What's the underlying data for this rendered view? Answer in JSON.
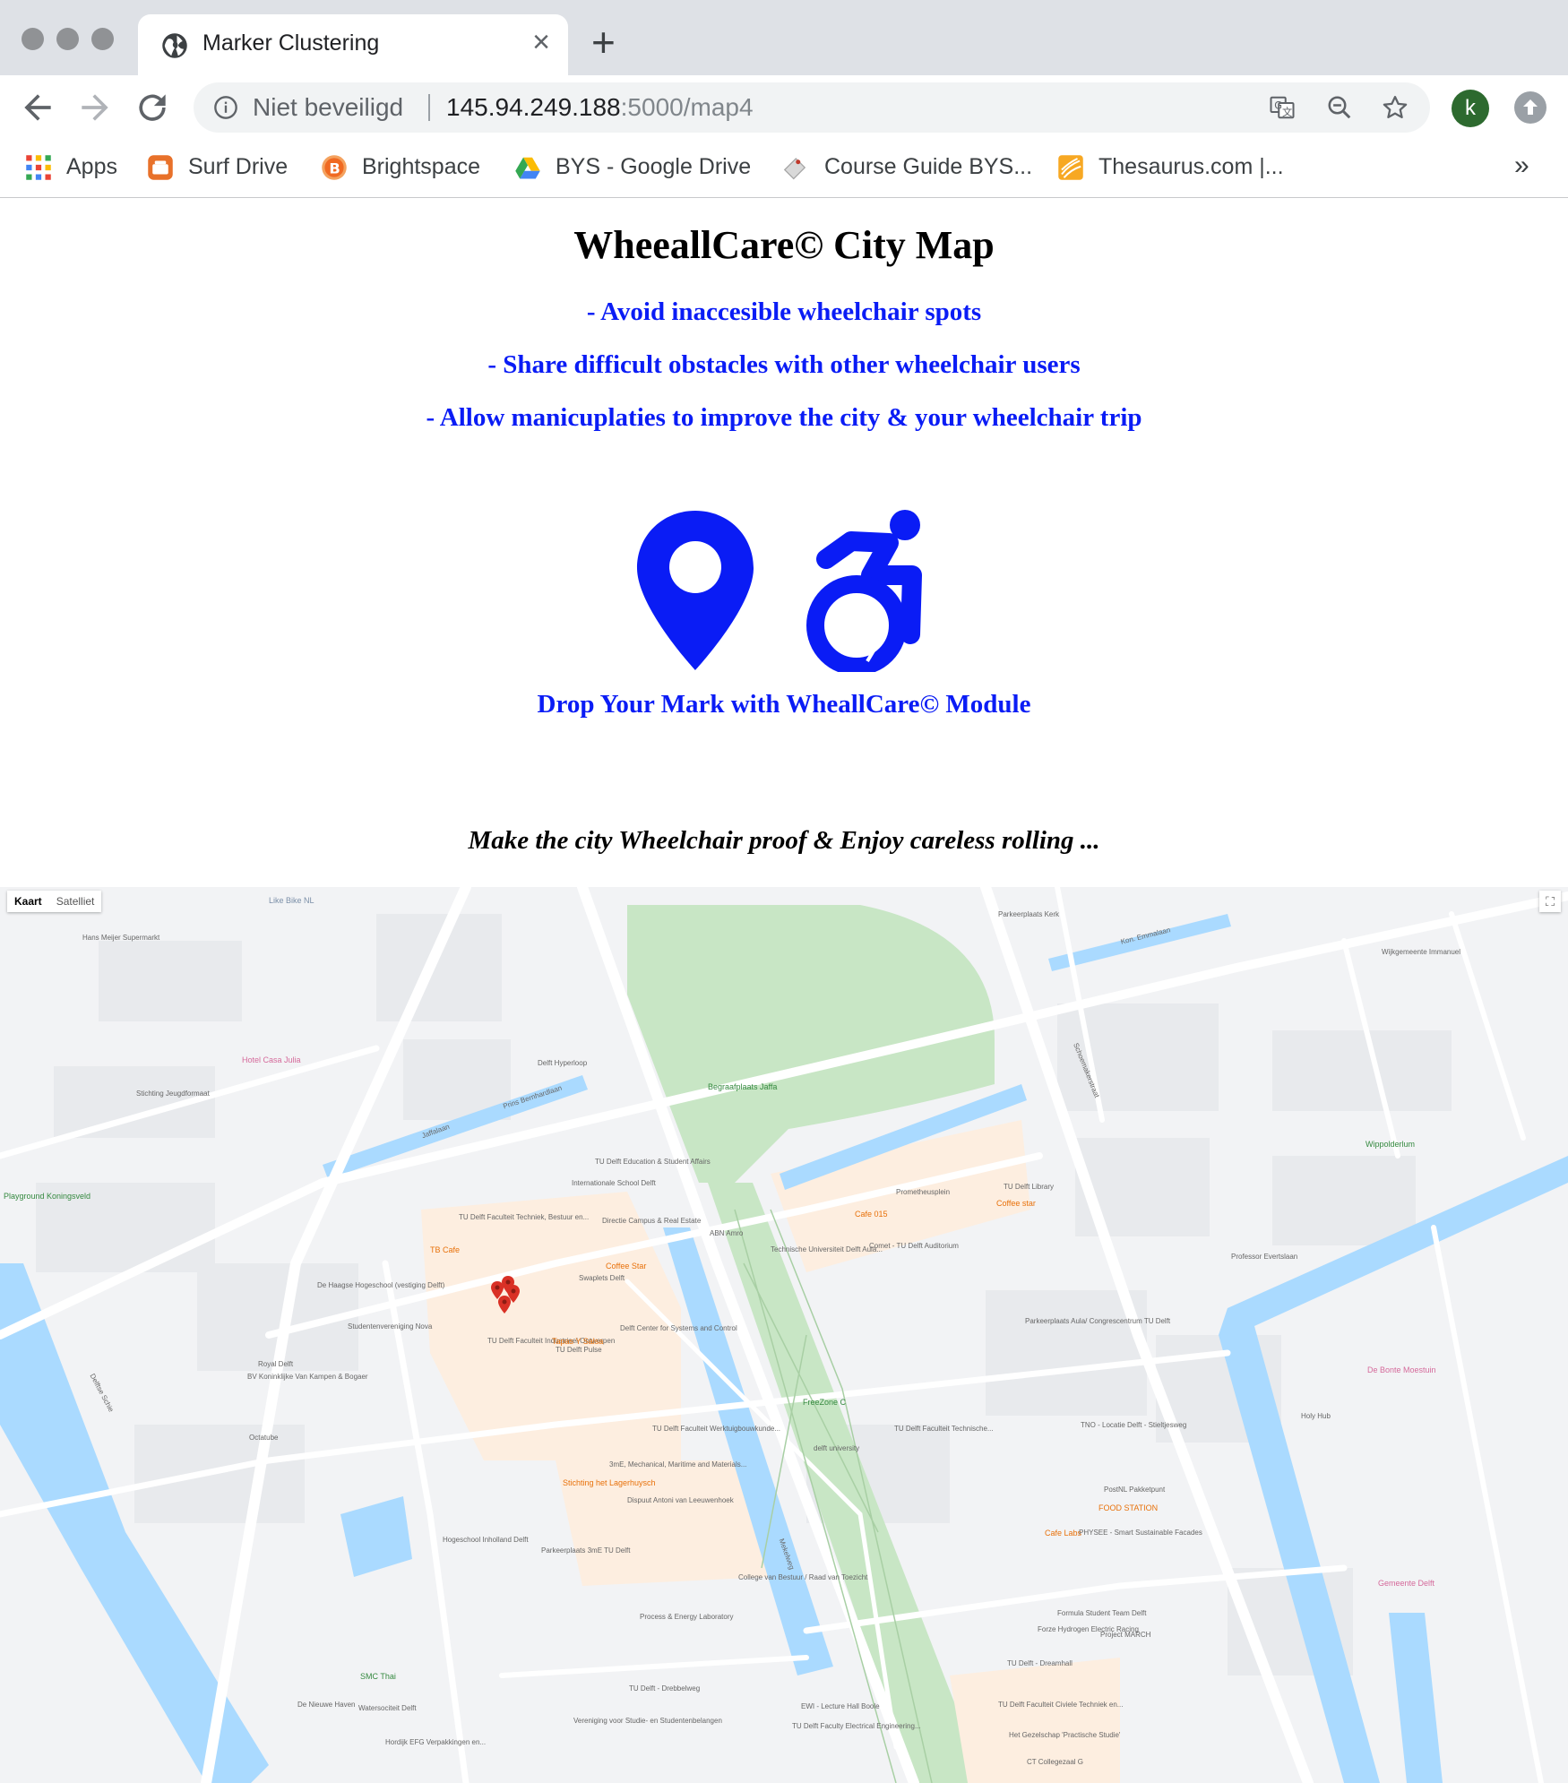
{
  "browser": {
    "tab_title": "Marker Clustering",
    "security_label": "Niet beveiligd",
    "url_host": "145.94.249.188",
    "url_path": ":5000/map4",
    "profile_initial": "k",
    "bookmarks": [
      {
        "label": "Apps",
        "icon": "apps-grid-icon"
      },
      {
        "label": "Surf Drive",
        "icon": "surfdrive-icon"
      },
      {
        "label": "Brightspace",
        "icon": "brightspace-icon"
      },
      {
        "label": "BYS - Google Drive",
        "icon": "google-drive-icon"
      },
      {
        "label": "Course Guide BYS...",
        "icon": "course-guide-icon"
      },
      {
        "label": "Thesaurus.com |...",
        "icon": "thesaurus-icon"
      }
    ],
    "more_bookmarks": "»"
  },
  "page": {
    "title": "WheeallCare© City Map",
    "bullets": [
      "- Avoid inaccesible wheelchair spots",
      "- Share difficult obstacles with other wheelchair users",
      "- Allow manicuplaties to improve the city & your wheelchair trip"
    ],
    "module_link": "Drop Your Mark with WheallCare© Module",
    "tagline": "Make the city Wheelchair proof & Enjoy careless rolling ..."
  },
  "map": {
    "type_buttons": {
      "map": "Kaart",
      "satellite": "Satelliet"
    },
    "fullscreen_icon": "fullscreen-icon",
    "labels": [
      "Like Bike NL",
      "Hans Meijer Supermarkt",
      "Hotel Casa Julia",
      "Delft Hyperloop",
      "Begraafplaats Jaffa",
      "Stichting Jeugdformaat",
      "Playground Koningsveld",
      "TU Delft Education & Student Affairs",
      "Internationale School Delft",
      "TU Delft Faculteit Techniek, Bestuur en...",
      "TB Cafe",
      "Directie Campus & Real Estate",
      "Coffee Star",
      "Swaplets Delft",
      "ABN Amro",
      "Technische Universiteit Delft Aula...",
      "Cafe 015",
      "Prometheusplein",
      "Coffee star",
      "TU Delft Library",
      "Comet - TU Delft Auditorium",
      "De Haagse Hogeschool (vestiging Delft)",
      "Studentenvereniging Nova",
      "TU Delft Faculteit Industrieel Ontwerpen",
      "Tapas Y Salsa",
      "TU Delft Pulse",
      "Delft Center for Systems and Control",
      "Royal Delft",
      "BV Koninklijke Van Kampen & Bogaer",
      "Octatube",
      "Parkeerplaats Aula/ Congrescentrum TU Delft",
      "FreeZone C",
      "delft university",
      "TU Delft Faculteit Werktuigbouwkunde...",
      "TU Delft Faculteit Technische...",
      "TNO - Locatie Delft - Stieltjesweg",
      "3mE, Mechanical, Maritime and Materials...",
      "Stichting het Lagerhuysch",
      "Dispuut Antoni van Leeuwenhoek",
      "PostNL Pakketpunt",
      "FOOD STATION",
      "Cafe Labs",
      "PHYSEE - Smart Sustainable Facades",
      "Hogeschool Inholland Delft",
      "Parkeerplaats 3mE TU Delft",
      "College van Bestuur / Raad van Toezicht",
      "Process & Energy Laboratory",
      "Formula Student Team Delft",
      "Forze Hydrogen Electric Racing",
      "Project MARCH",
      "TU Delft - Dreamhall",
      "Holy Hub",
      "De Bonte Moestuin",
      "Wippolderlum",
      "Gemeente Delft",
      "Parkeerplaats Kerk",
      "Wijkgemeente Immanuel",
      "SMC Thai",
      "De Nieuwe Haven",
      "Watersociteit Delft",
      "TU Delft - Drebbelweg",
      "EWI - Lecture Hall Boole",
      "TU Delft Faculty Electrical Engineering...",
      "TU Delft Faculteit Civiele Techniek en...",
      "Het Gezelschap 'Practische Studie'",
      "CT Collegezaal G",
      "Hordijk EFG Verpakkingen en...",
      "Vereniging voor Studie- en Studentenbelangen",
      "Jaffalaan",
      "Prins Bernhardlaan",
      "Mekelweg",
      "Schoemakerstraat",
      "Delftse Schie",
      "Kon. Emmalaan",
      "Professor Evertslaan"
    ],
    "marker_count": 4,
    "colors": {
      "water": "#aadaff",
      "park": "#c8e6c5",
      "campus": "#fdeee0",
      "road": "#ffffff",
      "marker": "#d93025"
    }
  },
  "colors": {
    "accent": "#0a1cf5",
    "title": "#000000"
  }
}
